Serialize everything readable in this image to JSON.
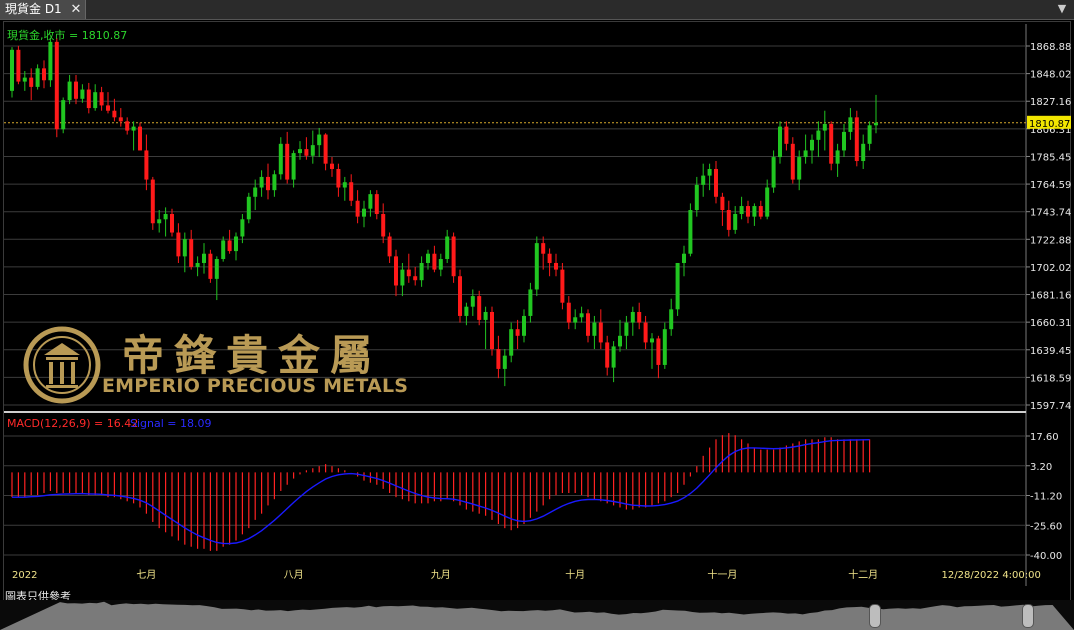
{
  "tab": {
    "title": "現貨金 D1",
    "close": "✕",
    "menu": "▼"
  },
  "chart_data": [
    {
      "type": "candlestick",
      "symbol_label": "現貨金,收市 = 1810.87",
      "current_price": "1810.87",
      "y_ticks": [
        "1868.88",
        "1848.02",
        "1827.16",
        "1806.31",
        "1785.45",
        "1764.59",
        "1743.74",
        "1722.88",
        "1702.02",
        "1681.16",
        "1660.31",
        "1639.45",
        "1618.59",
        "1597.74"
      ],
      "ylim": [
        1597.74,
        1868.88
      ],
      "x_tick_labels": [
        {
          "label": "2022",
          "bar": 0
        },
        {
          "label": "七月",
          "bar": 21
        },
        {
          "label": "八月",
          "bar": 44
        },
        {
          "label": "九月",
          "bar": 67
        },
        {
          "label": "十月",
          "bar": 88
        },
        {
          "label": "十一月",
          "bar": 111
        },
        {
          "label": "十二月",
          "bar": 133
        },
        {
          "label": "12/28/2022 4:00:00",
          "bar": 153
        }
      ],
      "colors": {
        "up": "#21c621",
        "down": "#ff1a1a",
        "price_line": "#d5a92c"
      },
      "candles": [
        [
          1835,
          1868,
          1830,
          1866
        ],
        [
          1866,
          1869,
          1840,
          1842
        ],
        [
          1842,
          1850,
          1835,
          1845
        ],
        [
          1845,
          1852,
          1828,
          1838
        ],
        [
          1838,
          1855,
          1836,
          1852
        ],
        [
          1852,
          1858,
          1837,
          1843
        ],
        [
          1843,
          1875,
          1838,
          1872
        ],
        [
          1872,
          1875,
          1800,
          1806
        ],
        [
          1806,
          1830,
          1803,
          1828
        ],
        [
          1828,
          1847,
          1825,
          1842
        ],
        [
          1842,
          1847,
          1825,
          1829
        ],
        [
          1829,
          1840,
          1826,
          1836
        ],
        [
          1836,
          1841,
          1818,
          1822
        ],
        [
          1822,
          1840,
          1820,
          1834
        ],
        [
          1834,
          1838,
          1820,
          1824
        ],
        [
          1824,
          1834,
          1818,
          1820
        ],
        [
          1820,
          1829,
          1812,
          1815
        ],
        [
          1815,
          1822,
          1808,
          1812
        ],
        [
          1812,
          1815,
          1802,
          1805
        ],
        [
          1805,
          1812,
          1790,
          1808
        ],
        [
          1808,
          1811,
          1790,
          1790
        ],
        [
          1790,
          1802,
          1760,
          1768
        ],
        [
          1768,
          1770,
          1730,
          1735
        ],
        [
          1735,
          1745,
          1728,
          1738
        ],
        [
          1738,
          1747,
          1725,
          1742
        ],
        [
          1742,
          1746,
          1725,
          1728
        ],
        [
          1728,
          1735,
          1705,
          1710
        ],
        [
          1710,
          1728,
          1698,
          1723
        ],
        [
          1723,
          1730,
          1700,
          1702
        ],
        [
          1702,
          1710,
          1695,
          1705
        ],
        [
          1705,
          1720,
          1697,
          1712
        ],
        [
          1712,
          1715,
          1690,
          1693
        ],
        [
          1693,
          1710,
          1677,
          1708
        ],
        [
          1708,
          1725,
          1706,
          1722
        ],
        [
          1722,
          1730,
          1712,
          1714
        ],
        [
          1714,
          1728,
          1707,
          1725
        ],
        [
          1725,
          1742,
          1720,
          1738
        ],
        [
          1738,
          1758,
          1735,
          1755
        ],
        [
          1755,
          1768,
          1745,
          1762
        ],
        [
          1762,
          1775,
          1755,
          1770
        ],
        [
          1770,
          1780,
          1753,
          1760
        ],
        [
          1760,
          1775,
          1755,
          1772
        ],
        [
          1772,
          1800,
          1768,
          1795
        ],
        [
          1795,
          1804,
          1765,
          1768
        ],
        [
          1768,
          1790,
          1762,
          1788
        ],
        [
          1788,
          1797,
          1783,
          1791
        ],
        [
          1791,
          1800,
          1783,
          1786
        ],
        [
          1786,
          1805,
          1780,
          1794
        ],
        [
          1794,
          1807,
          1785,
          1802
        ],
        [
          1802,
          1803,
          1775,
          1780
        ],
        [
          1780,
          1785,
          1770,
          1776
        ],
        [
          1776,
          1780,
          1755,
          1762
        ],
        [
          1762,
          1770,
          1752,
          1766
        ],
        [
          1766,
          1772,
          1748,
          1752
        ],
        [
          1752,
          1760,
          1735,
          1740
        ],
        [
          1740,
          1752,
          1732,
          1746
        ],
        [
          1746,
          1760,
          1740,
          1757
        ],
        [
          1757,
          1760,
          1738,
          1742
        ],
        [
          1742,
          1750,
          1720,
          1725
        ],
        [
          1725,
          1728,
          1705,
          1710
        ],
        [
          1710,
          1715,
          1680,
          1688
        ],
        [
          1688,
          1705,
          1680,
          1700
        ],
        [
          1700,
          1712,
          1690,
          1695
        ],
        [
          1695,
          1702,
          1688,
          1692
        ],
        [
          1692,
          1710,
          1687,
          1705
        ],
        [
          1705,
          1715,
          1700,
          1712
        ],
        [
          1712,
          1718,
          1698,
          1700
        ],
        [
          1700,
          1712,
          1695,
          1708
        ],
        [
          1708,
          1730,
          1705,
          1725
        ],
        [
          1725,
          1728,
          1690,
          1695
        ],
        [
          1695,
          1700,
          1660,
          1665
        ],
        [
          1665,
          1675,
          1658,
          1672
        ],
        [
          1672,
          1685,
          1665,
          1680
        ],
        [
          1680,
          1684,
          1658,
          1662
        ],
        [
          1662,
          1672,
          1640,
          1668
        ],
        [
          1668,
          1672,
          1635,
          1640
        ],
        [
          1640,
          1650,
          1618,
          1625
        ],
        [
          1625,
          1640,
          1612,
          1635
        ],
        [
          1635,
          1660,
          1630,
          1655
        ],
        [
          1655,
          1662,
          1640,
          1650
        ],
        [
          1650,
          1670,
          1645,
          1665
        ],
        [
          1665,
          1690,
          1660,
          1685
        ],
        [
          1685,
          1725,
          1680,
          1720
        ],
        [
          1720,
          1725,
          1700,
          1712
        ],
        [
          1712,
          1716,
          1695,
          1705
        ],
        [
          1705,
          1712,
          1695,
          1700
        ],
        [
          1700,
          1705,
          1670,
          1675
        ],
        [
          1675,
          1680,
          1655,
          1660
        ],
        [
          1660,
          1670,
          1655,
          1664
        ],
        [
          1664,
          1672,
          1660,
          1667
        ],
        [
          1667,
          1670,
          1645,
          1650
        ],
        [
          1650,
          1665,
          1640,
          1660
        ],
        [
          1660,
          1670,
          1640,
          1645
        ],
        [
          1645,
          1650,
          1620,
          1626
        ],
        [
          1626,
          1646,
          1615,
          1642
        ],
        [
          1642,
          1662,
          1638,
          1650
        ],
        [
          1650,
          1665,
          1640,
          1660
        ],
        [
          1660,
          1672,
          1650,
          1668
        ],
        [
          1668,
          1675,
          1655,
          1660
        ],
        [
          1660,
          1665,
          1640,
          1645
        ],
        [
          1645,
          1652,
          1625,
          1648
        ],
        [
          1648,
          1650,
          1618,
          1628
        ],
        [
          1628,
          1660,
          1625,
          1655
        ],
        [
          1655,
          1678,
          1650,
          1670
        ],
        [
          1670,
          1690,
          1665,
          1705
        ],
        [
          1705,
          1718,
          1695,
          1712
        ],
        [
          1712,
          1750,
          1710,
          1745
        ],
        [
          1745,
          1770,
          1740,
          1764
        ],
        [
          1764,
          1780,
          1755,
          1771
        ],
        [
          1771,
          1780,
          1760,
          1776
        ],
        [
          1776,
          1782,
          1750,
          1755
        ],
        [
          1755,
          1758,
          1733,
          1745
        ],
        [
          1745,
          1752,
          1725,
          1730
        ],
        [
          1730,
          1748,
          1727,
          1742
        ],
        [
          1742,
          1755,
          1738,
          1748
        ],
        [
          1748,
          1752,
          1735,
          1740
        ],
        [
          1740,
          1750,
          1733,
          1748
        ],
        [
          1748,
          1752,
          1738,
          1740
        ],
        [
          1740,
          1768,
          1738,
          1762
        ],
        [
          1762,
          1790,
          1758,
          1785
        ],
        [
          1785,
          1812,
          1780,
          1808
        ],
        [
          1808,
          1812,
          1790,
          1795
        ],
        [
          1795,
          1800,
          1765,
          1768
        ],
        [
          1768,
          1790,
          1760,
          1785
        ],
        [
          1785,
          1802,
          1780,
          1790
        ],
        [
          1790,
          1802,
          1780,
          1798
        ],
        [
          1798,
          1812,
          1785,
          1805
        ],
        [
          1805,
          1820,
          1790,
          1810
        ],
        [
          1810,
          1812,
          1775,
          1780
        ],
        [
          1780,
          1795,
          1770,
          1790
        ],
        [
          1790,
          1810,
          1785,
          1804
        ],
        [
          1804,
          1822,
          1798,
          1815
        ],
        [
          1815,
          1820,
          1778,
          1782
        ],
        [
          1782,
          1802,
          1776,
          1795
        ],
        [
          1795,
          1812,
          1790,
          1809
        ],
        [
          1809,
          1832,
          1803,
          1810.87
        ]
      ]
    },
    {
      "type": "histogram+line",
      "label_macd": "MACD(12,26,9) = 16.42",
      "label_signal": "Signal = 18.09",
      "y_ticks": [
        "17.60",
        "3.20",
        "-11.20",
        "-25.60",
        "-40.00"
      ],
      "ylim": [
        -40.0,
        17.6
      ],
      "colors": {
        "hist": "#ff2222",
        "signal": "#1a1aff"
      },
      "macd": [
        -12,
        -12,
        -12,
        -11,
        -11,
        -10,
        -9,
        -10,
        -10,
        -10,
        -10,
        -10,
        -11,
        -11,
        -11,
        -12,
        -12,
        -13,
        -14,
        -15,
        -17,
        -20,
        -24,
        -27,
        -29,
        -31,
        -33,
        -35,
        -36,
        -37,
        -37,
        -38,
        -38,
        -36,
        -35,
        -33,
        -30,
        -27,
        -23,
        -20,
        -16,
        -13,
        -9,
        -6,
        -3,
        -1,
        1,
        2,
        3,
        4,
        3,
        2,
        1,
        0,
        -2,
        -4,
        -5,
        -6,
        -8,
        -10,
        -12,
        -13,
        -14,
        -15,
        -15,
        -15,
        -14,
        -14,
        -13,
        -14,
        -16,
        -18,
        -19,
        -20,
        -21,
        -23,
        -25,
        -27,
        -28,
        -27,
        -25,
        -22,
        -19,
        -16,
        -13,
        -11,
        -10,
        -10,
        -10,
        -11,
        -12,
        -13,
        -14,
        -15,
        -16,
        -17,
        -18,
        -18,
        -17,
        -17,
        -16,
        -15,
        -14,
        -12,
        -10,
        -6,
        -2,
        3,
        8,
        12,
        16,
        18,
        19,
        18,
        16,
        14,
        12,
        11,
        11,
        11,
        12,
        13,
        14,
        15,
        16,
        16,
        16,
        17,
        17,
        16,
        16,
        16,
        16,
        16,
        16
      ]
    }
  ],
  "brand": {
    "name_cn": "帝鋒貴金屬",
    "name_en": "EMPERIO PRECIOUS METALS"
  },
  "footer_note": "圖表只供參考"
}
